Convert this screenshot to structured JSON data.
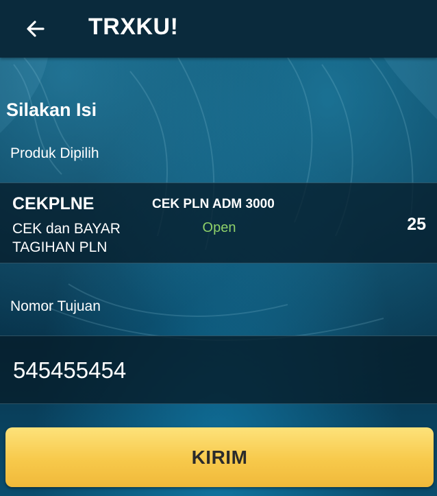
{
  "appbar": {
    "title": "TRXKU!",
    "back_icon": "arrow-left-icon"
  },
  "form": {
    "heading": "Silakan Isi",
    "product_label": "Produk Dipilih",
    "product": {
      "code": "CEKPLNE",
      "description": "CEK dan BAYAR TAGIHAN PLN",
      "name": "CEK PLN ADM 3000",
      "status": "Open",
      "price": "25"
    },
    "target_label": "Nomor Tujuan",
    "target_value": "545455454",
    "submit_label": "KIRIM"
  },
  "colors": {
    "appbar_bg": "#0a2a3c",
    "background": "#0a3c56",
    "status_open": "#8fd16a",
    "button": "#f7c94b",
    "button_text": "#2b2b2b"
  }
}
